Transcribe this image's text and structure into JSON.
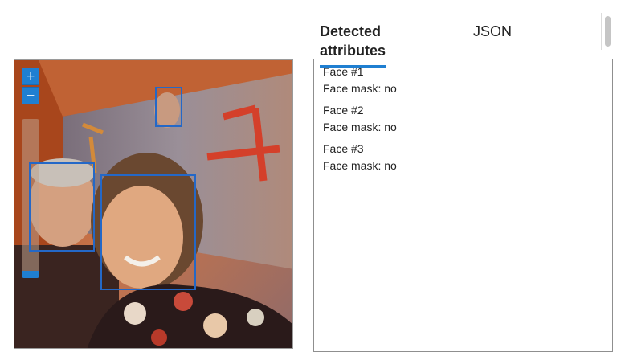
{
  "tabs": [
    {
      "label": "Detected attributes",
      "active": true
    },
    {
      "label": "JSON",
      "active": false
    }
  ],
  "viewer": {
    "zoom_in_label": "+",
    "zoom_out_label": "−",
    "zoom_level_fraction": 0.05,
    "face_count": 3
  },
  "results": {
    "faces": [
      {
        "title": "Face #1",
        "mask": "Face mask: no"
      },
      {
        "title": "Face #2",
        "mask": "Face mask: no"
      },
      {
        "title": "Face #3",
        "mask": "Face mask: no"
      }
    ]
  },
  "colors": {
    "accent": "#1f7fd1",
    "face_box": "#2468c7",
    "border": "#8f8f8f"
  }
}
